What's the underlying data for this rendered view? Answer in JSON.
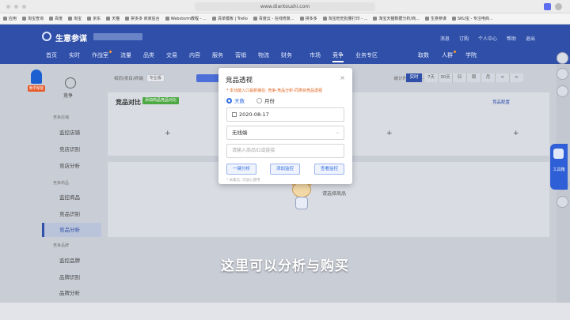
{
  "browser": {
    "url": "www.diantoushi.com",
    "bookmarks": [
      "应用",
      "淘宝查询",
      "百度",
      "淘宝",
      "京东",
      "天猫",
      "拼多多 商家后台",
      "Webstorm教程 - ...",
      "清单模板 | Trello",
      "百度云 - 在线修复...",
      "拼多多",
      "淘宝旺旺批量打印 - ...",
      "淘宝天猫数据分析/商...",
      "生意参谋",
      "SKU宝 - 专注电商..."
    ]
  },
  "app": {
    "brand": "生意参谋",
    "top_links": [
      "消息",
      "订购",
      "个人中心",
      "帮助",
      "退出"
    ],
    "main_nav": [
      "首页",
      "实时",
      "作战室",
      "流量",
      "品类",
      "交易",
      "内容",
      "服务",
      "营销",
      "物流",
      "财务",
      "市场",
      "竞争",
      "业务专区"
    ],
    "active_nav": "竞争",
    "nav_right": [
      "取数",
      "人群",
      "学院"
    ]
  },
  "sidebar": {
    "badge": "数字赋能",
    "tab": "竞争",
    "groups": [
      {
        "label": "竞争店铺",
        "items": [
          "监控店铺",
          "竞店识别",
          "竞店分析"
        ]
      },
      {
        "label": "竞争商品",
        "items": [
          "监控商品",
          "竞品识别",
          "竞品分析"
        ]
      },
      {
        "label": "竞争品牌",
        "items": [
          "监控品牌",
          "品牌识别",
          "品牌分析"
        ]
      }
    ],
    "active_item": "竞品分析"
  },
  "filter": {
    "labels": [
      "相同/类目/终端",
      "专业版"
    ],
    "time_label": "统计时间 --:--:--",
    "realtime": "实时",
    "periods": [
      "7天",
      "30天",
      "日",
      "周",
      "月",
      "<",
      ">"
    ]
  },
  "panel": {
    "title": "竞品对比",
    "add_button": "添加商品竞品对比",
    "config_link": "竞品配置",
    "empty_text": "请选择商品"
  },
  "modal": {
    "title": "竞品透视",
    "close": "×",
    "note": "* 本功能入口是新接在: 竞争-竞品分析-同类目竞品透视",
    "radio_day": "天数",
    "radio_month": "月份",
    "date": "2020-08-17",
    "terminal": "无线端",
    "search_placeholder": "请输入商品ID或链接",
    "btn_analyze": "一键分析",
    "btn_add": "添加监控",
    "btn_view": "查看监控",
    "footer": "* 采集信, 可放心使用"
  },
  "toolbox_label": "工具箱",
  "subtitle": "这里可以分析与购买"
}
